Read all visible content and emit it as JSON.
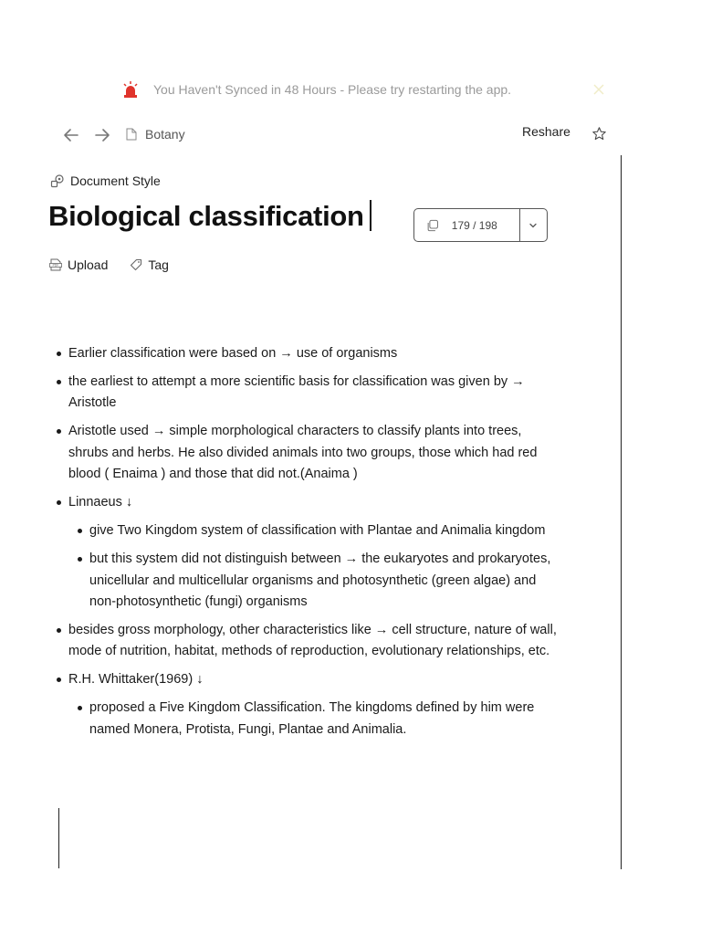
{
  "banner": {
    "message": "You Haven't Synced in 48 Hours - Please try restarting the app."
  },
  "toolbar": {
    "breadcrumb": "Botany",
    "reshare_label": "Reshare"
  },
  "doc": {
    "style_label": "Document Style",
    "title": "Biological classification",
    "pager": {
      "count": "179 / 198"
    },
    "meta": {
      "upload_label": "Upload",
      "tag_label": "Tag"
    }
  },
  "content": {
    "bullets": [
      {
        "text": "Earlier classification were based on → use of organisms"
      },
      {
        "text": "the earliest to attempt a more scientific basis for classification  was given by → Aristotle"
      },
      {
        "text": "Aristotle used → simple morphological characters to classify plants into trees, shrubs and herbs. He also divided animals into two groups, those which had red blood ( Enaima ) and those that did not.(Anaima )"
      },
      {
        "text": "Linnaeus ↓",
        "children": [
          {
            "text": "give   Two Kingdom system of classification with Plantae and Animalia kingdom"
          },
          {
            "text": "but this system did not distinguish between → the eukaryotes and prokaryotes, unicellular and multicellular organisms and photosynthetic (green algae) and non-photosynthetic (fungi) organisms"
          }
        ]
      },
      {
        "text": "besides gross morphology, other characteristics like → cell structure, nature of wall, mode of nutrition, habitat, methods of reproduction, evolutionary relationships, etc."
      },
      {
        "text": "R.H. Whittaker(1969) ↓",
        "children": [
          {
            "text": "proposed a Five Kingdom Classification. The kingdoms defined by him were named Monera, Protista, Fungi, Plantae and Animalia."
          }
        ]
      }
    ]
  },
  "colors": {
    "alarm": "#e0342c",
    "banner_text": "#9a9a9a",
    "text": "#1a1a1a"
  },
  "icons": {
    "alarm": "alarm-icon",
    "close": "close-icon",
    "back": "arrow-left-icon",
    "forward": "arrow-right-icon",
    "document": "document-icon",
    "star": "star-icon",
    "style": "document-style-icon",
    "pager": "copy-icon",
    "chevron": "chevron-down-icon",
    "upload": "pdf-icon",
    "tag": "tag-icon"
  }
}
